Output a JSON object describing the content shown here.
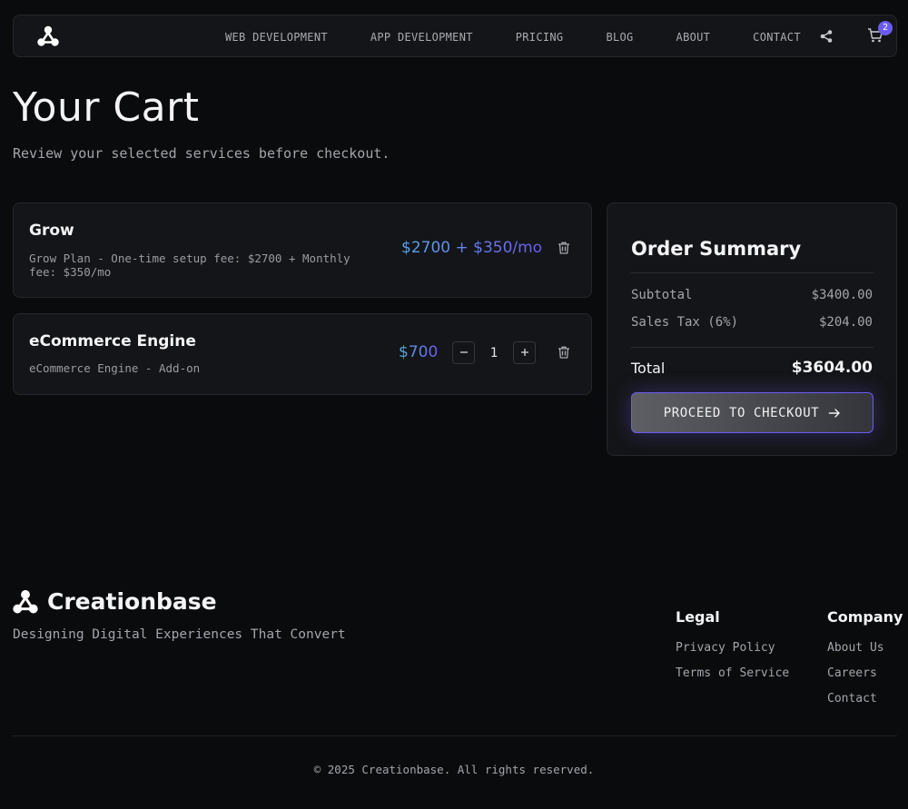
{
  "nav": {
    "links": [
      "WEB DEVELOPMENT",
      "APP DEVELOPMENT",
      "PRICING",
      "BLOG",
      "ABOUT",
      "CONTACT"
    ],
    "cart_count": "2"
  },
  "header": {
    "title": "Your Cart",
    "subtitle": "Review your selected services before checkout."
  },
  "cart": {
    "items": [
      {
        "name": "Grow",
        "description": "Grow Plan - One-time setup fee: $2700 + Monthly fee: $350/mo",
        "price": "$2700 + $350/mo"
      },
      {
        "name": "eCommerce Engine",
        "description": "eCommerce Engine - Add-on",
        "price": "$700",
        "quantity": "1"
      }
    ]
  },
  "summary": {
    "title": "Order Summary",
    "subtotal_label": "Subtotal",
    "subtotal_value": "$3400.00",
    "tax_label": "Sales Tax (6%)",
    "tax_value": "$204.00",
    "total_label": "Total",
    "total_value": "$3604.00",
    "checkout_label": "PROCEED TO CHECKOUT"
  },
  "footer": {
    "brand": "Creationbase",
    "tagline": "Designing Digital Experiences That Convert",
    "legal_title": "Legal",
    "legal_links": [
      "Privacy Policy",
      "Terms of Service"
    ],
    "company_title": "Company",
    "company_links": [
      "About Us",
      "Careers",
      "Contact"
    ],
    "copyright": "© 2025 Creationbase. All rights reserved."
  },
  "colors": {
    "background": "#0a0b0d",
    "card": "#141518",
    "accent": "#6b5cf0",
    "price_gradient_start": "#5aa7e8"
  }
}
